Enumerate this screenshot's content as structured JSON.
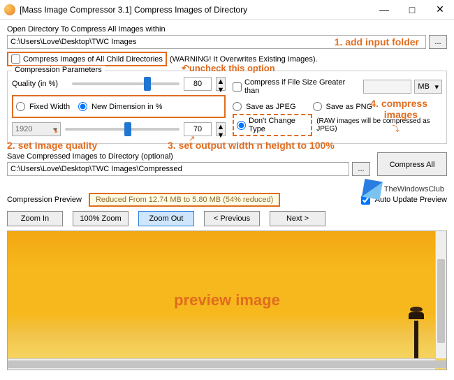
{
  "window": {
    "title": "[Mass Image Compressor 3.1] Compress Images of Directory",
    "minimize": "—",
    "maximize": "□",
    "close": "✕"
  },
  "open_dir": {
    "label": "Open Directory To Compress All Images within",
    "path": "C:\\Users\\Love\\Desktop\\TWC Images",
    "browse": "..."
  },
  "child_dirs": {
    "checkbox_label": "Compress Images of All Child Directories",
    "warning": "(WARNING! It Overwrites Existing Images).",
    "checked": false
  },
  "params": {
    "legend": "Compression Parameters",
    "quality_label": "Quality (in %)",
    "quality_value": "80",
    "fixed_width_label": "Fixed Width",
    "new_dim_label": "New Dimension in %",
    "width_value": "1920",
    "dim_value": "70"
  },
  "right": {
    "size_check_label": "Compress if File Size Greater than",
    "size_unit": "MB",
    "save_jpeg_label": "Save as JPEG",
    "save_png_label": "Save as PNG",
    "dont_change_label": "Don't Change Type",
    "dont_change_note": "(RAW images will be compressed as JPEG)"
  },
  "save": {
    "label": "Save Compressed Images to Directory (optional)",
    "path": "C:\\Users\\Love\\Desktop\\TWC Images\\Compressed",
    "browse": "...",
    "compress_btn": "Compress All"
  },
  "preview": {
    "legend": "Compression Preview",
    "status": "Reduced From 12.74 MB to 5.80 MB (54% reduced)",
    "auto_update": "Auto Update Preview",
    "zoom_in": "Zoom In",
    "zoom_100": "100% Zoom",
    "zoom_out": "Zoom Out",
    "previous": "< Previous",
    "next": "Next >"
  },
  "annotations": {
    "a1": "1. add input folder",
    "a2_uncheck": "↶uncheck this option",
    "a2": "2. set image quality",
    "a3": "3. set output width n height to 100%",
    "a4a": "4. compress",
    "a4b": "images",
    "preview_label": "preview image"
  },
  "watermark": "TheWindowsClub"
}
